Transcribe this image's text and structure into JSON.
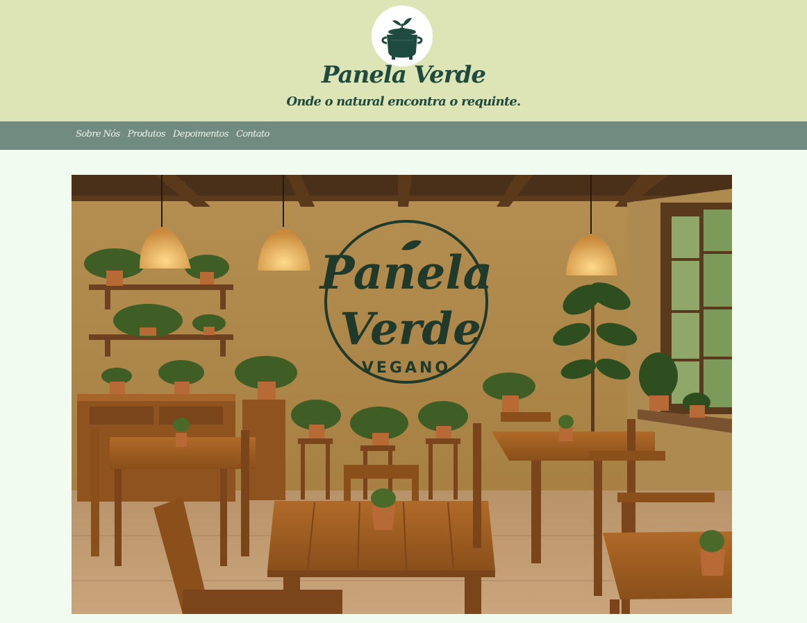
{
  "header": {
    "logo_icon": "cooking-pot-with-leaf-icon",
    "title": "Panela Verde",
    "tagline": "Onde o natural encontra o requinte."
  },
  "nav": {
    "items": [
      {
        "label": "Sobre Nós"
      },
      {
        "label": "Produtos"
      },
      {
        "label": "Depoimentos"
      },
      {
        "label": "Contato"
      }
    ]
  },
  "hero": {
    "sign": {
      "line1": "Panela",
      "line2": "Verde",
      "line3": "VEGANO"
    }
  },
  "colors": {
    "header_bg": "#dde5b6",
    "nav_bg": "#728b80",
    "page_bg": "#f2fbf0",
    "brand_green": "#1f4a3f"
  }
}
